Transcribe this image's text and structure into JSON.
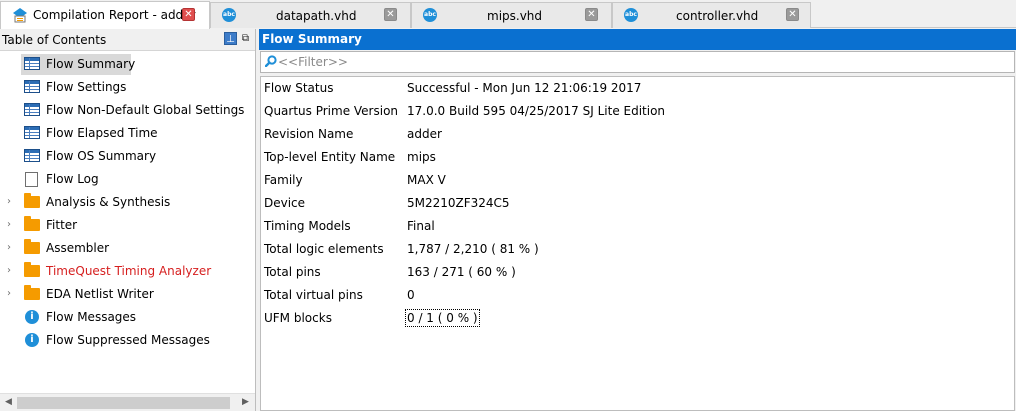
{
  "tabs": [
    {
      "label": "Compilation Report - adder",
      "icon": "compile-report-icon",
      "active": true
    },
    {
      "label": "datapath.vhd",
      "icon": "abc-file-icon"
    },
    {
      "label": "mips.vhd",
      "icon": "abc-file-icon"
    },
    {
      "label": "controller.vhd",
      "icon": "abc-file-icon"
    }
  ],
  "tab_icon_text": "abc",
  "close_glyph": "✕",
  "left_panel": {
    "title": "Table of Contents",
    "pin_glyph": "⊥",
    "float_glyph": "⧉",
    "items": [
      {
        "label": "Flow Summary",
        "icon": "table-icon"
      },
      {
        "label": "Flow Settings",
        "icon": "table-icon"
      },
      {
        "label": "Flow Non-Default Global Settings",
        "icon": "table-icon"
      },
      {
        "label": "Flow Elapsed Time",
        "icon": "table-icon"
      },
      {
        "label": "Flow OS Summary",
        "icon": "table-icon"
      },
      {
        "label": "Flow Log",
        "icon": "document-icon"
      },
      {
        "label": "Analysis & Synthesis",
        "icon": "folder-icon"
      },
      {
        "label": "Fitter",
        "icon": "folder-icon"
      },
      {
        "label": "Assembler",
        "icon": "folder-icon"
      },
      {
        "label": "TimeQuest Timing Analyzer",
        "icon": "folder-icon"
      },
      {
        "label": "EDA Netlist Writer",
        "icon": "folder-icon"
      },
      {
        "label": "Flow Messages",
        "icon": "info-icon"
      },
      {
        "label": "Flow Suppressed Messages",
        "icon": "info-icon"
      }
    ],
    "expand_glyph": "›",
    "info_glyph": "i",
    "error_color": "#d61f1f"
  },
  "right_panel": {
    "title": "Flow Summary",
    "filter_placeholder": "<<Filter>>",
    "rows": [
      {
        "key": "Flow Status",
        "value": "Successful - Mon Jun 12 21:06:19 2017"
      },
      {
        "key": "Quartus Prime Version",
        "value": "17.0.0 Build 595 04/25/2017 SJ Lite Edition"
      },
      {
        "key": "Revision Name",
        "value": "adder"
      },
      {
        "key": "Top-level Entity Name",
        "value": "mips"
      },
      {
        "key": "Family",
        "value": "MAX V"
      },
      {
        "key": "Device",
        "value": "5M2210ZF324C5"
      },
      {
        "key": "Timing Models",
        "value": "Final"
      },
      {
        "key": "Total logic elements",
        "value": "1,787 / 2,210 ( 81 % )"
      },
      {
        "key": "Total pins",
        "value": "163 / 271 ( 60 % )"
      },
      {
        "key": "Total virtual pins",
        "value": "0"
      },
      {
        "key": "UFM blocks",
        "value": "0 / 1 ( 0 % )"
      }
    ]
  },
  "colors": {
    "header_blue": "#0a70d0",
    "close_red": "#e04f4f",
    "folder_orange": "#f59b00",
    "info_blue": "#1f8fd8"
  }
}
